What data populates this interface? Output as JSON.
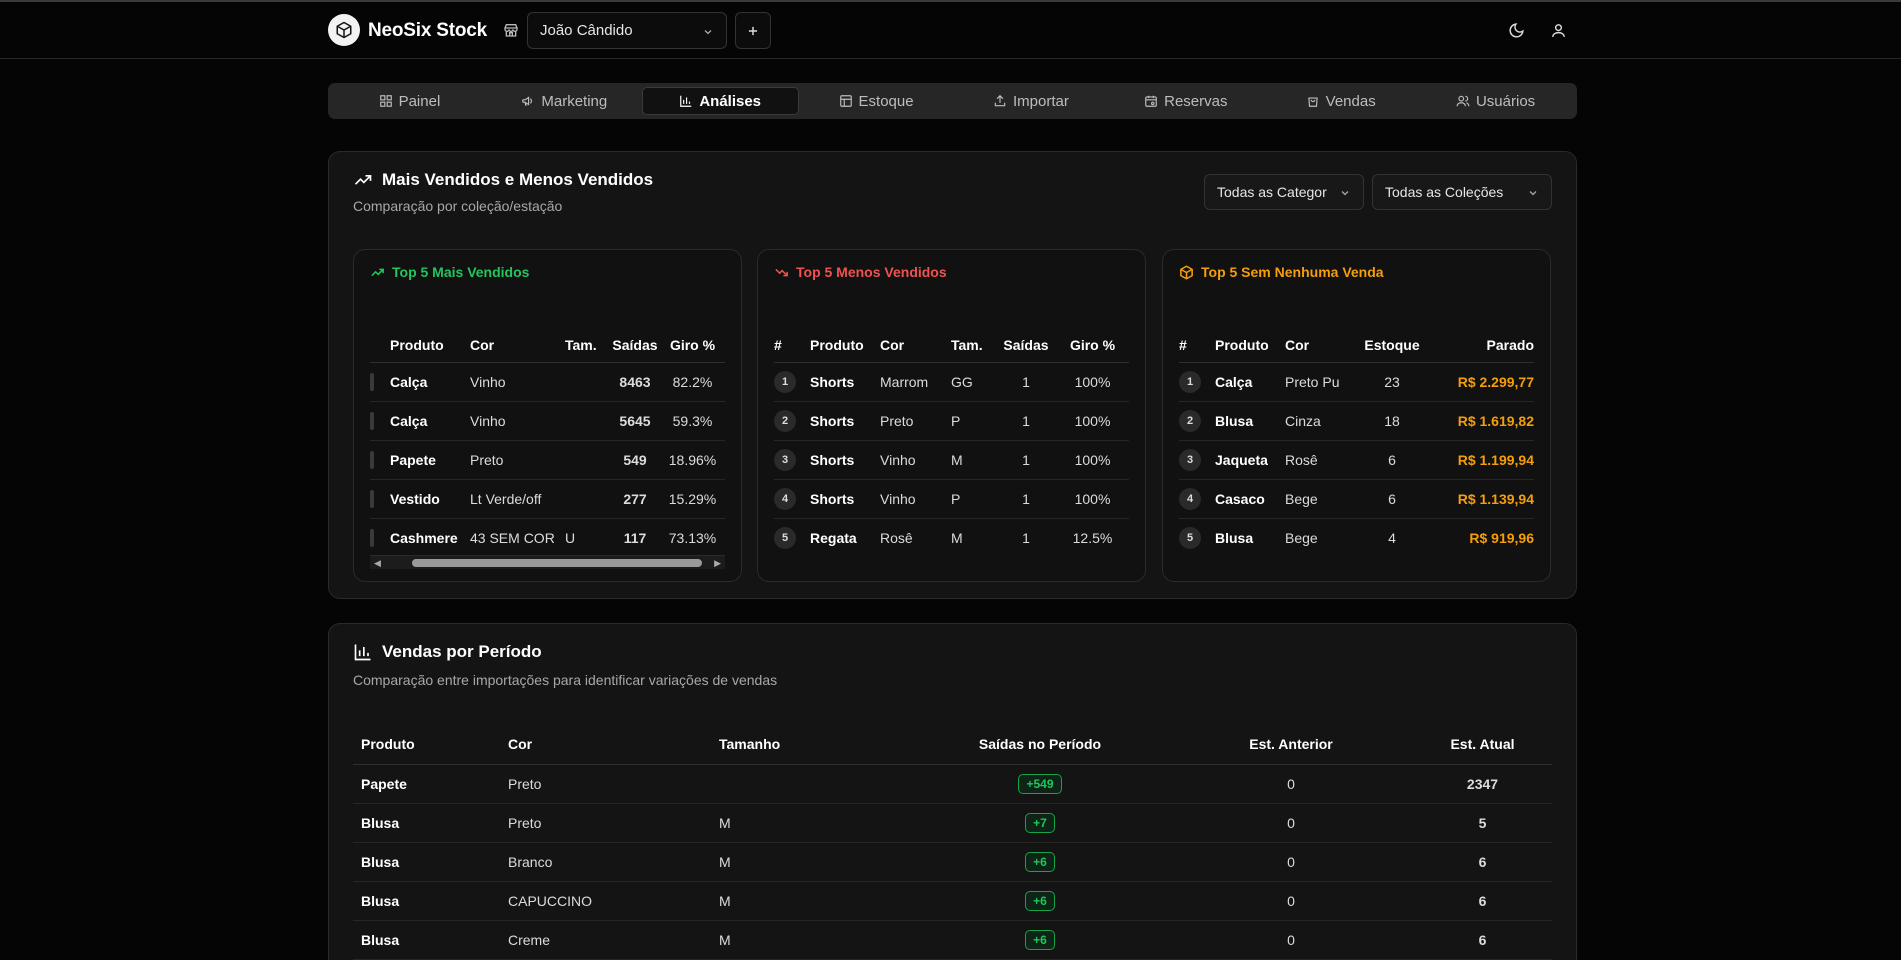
{
  "header": {
    "app_title": "NeoSix Stock",
    "store_selected": "João Cândido"
  },
  "nav": {
    "tabs": [
      {
        "label": "Painel",
        "icon": "dashboard-icon"
      },
      {
        "label": "Marketing",
        "icon": "megaphone-icon"
      },
      {
        "label": "Análises",
        "icon": "bar-chart-icon",
        "active": true
      },
      {
        "label": "Estoque",
        "icon": "table-icon"
      },
      {
        "label": "Importar",
        "icon": "upload-icon"
      },
      {
        "label": "Reservas",
        "icon": "calendar-icon"
      },
      {
        "label": "Vendas",
        "icon": "shopping-bag-icon"
      },
      {
        "label": "Usuários",
        "icon": "users-icon"
      }
    ]
  },
  "best_sellers": {
    "title": "Mais Vendidos e Menos Vendidos",
    "subtitle": "Comparação por coleção/estação",
    "filter_category": "Todas as Categor",
    "filter_collection": "Todas as Coleções",
    "top": {
      "title": "Top 5 Mais Vendidos",
      "headers": [
        "Produto",
        "Cor",
        "Tam.",
        "Saídas",
        "Giro %"
      ],
      "rows": [
        {
          "produto": "Calça",
          "cor": "Vinho",
          "tam": "",
          "saidas": "8463",
          "giro": "82.2%"
        },
        {
          "produto": "Calça",
          "cor": "Vinho",
          "tam": "",
          "saidas": "5645",
          "giro": "59.3%"
        },
        {
          "produto": "Papete",
          "cor": "Preto",
          "tam": "",
          "saidas": "549",
          "giro": "18.96%"
        },
        {
          "produto": "Vestido",
          "cor": "Lt Verde/off",
          "tam": "",
          "saidas": "277",
          "giro": "15.29%"
        },
        {
          "produto": "Cashmere",
          "cor": "43 SEM COR",
          "tam": "U",
          "saidas": "117",
          "giro": "73.13%"
        }
      ]
    },
    "bottom": {
      "title": "Top 5 Menos Vendidos",
      "headers": [
        "#",
        "Produto",
        "Cor",
        "Tam.",
        "Saídas",
        "Giro %"
      ],
      "rows": [
        {
          "rank": "1",
          "produto": "Shorts",
          "cor": "Marrom",
          "tam": "GG",
          "saidas": "1",
          "giro": "100%"
        },
        {
          "rank": "2",
          "produto": "Shorts",
          "cor": "Preto",
          "tam": "P",
          "saidas": "1",
          "giro": "100%"
        },
        {
          "rank": "3",
          "produto": "Shorts",
          "cor": "Vinho",
          "tam": "M",
          "saidas": "1",
          "giro": "100%"
        },
        {
          "rank": "4",
          "produto": "Shorts",
          "cor": "Vinho",
          "tam": "P",
          "saidas": "1",
          "giro": "100%"
        },
        {
          "rank": "5",
          "produto": "Regata",
          "cor": "Rosê",
          "tam": "M",
          "saidas": "1",
          "giro": "12.5%"
        }
      ]
    },
    "nosale": {
      "title": "Top 5 Sem Nenhuma Venda",
      "headers": [
        "#",
        "Produto",
        "Cor",
        "Estoque",
        "Parado"
      ],
      "rows": [
        {
          "rank": "1",
          "produto": "Calça",
          "cor": "Preto Pu",
          "estoque": "23",
          "parado": "R$ 2.299,77"
        },
        {
          "rank": "2",
          "produto": "Blusa",
          "cor": "Cinza",
          "estoque": "18",
          "parado": "R$ 1.619,82"
        },
        {
          "rank": "3",
          "produto": "Jaqueta",
          "cor": "Rosê",
          "estoque": "6",
          "parado": "R$ 1.199,94"
        },
        {
          "rank": "4",
          "produto": "Casaco",
          "cor": "Bege",
          "estoque": "6",
          "parado": "R$ 1.139,94"
        },
        {
          "rank": "5",
          "produto": "Blusa",
          "cor": "Bege",
          "estoque": "4",
          "parado": "R$ 919,96"
        }
      ]
    }
  },
  "period_sales": {
    "title": "Vendas por Período",
    "subtitle": "Comparação entre importações para identificar variações de vendas",
    "headers": [
      "Produto",
      "Cor",
      "Tamanho",
      "Saídas no Período",
      "Est. Anterior",
      "Est. Atual"
    ],
    "rows": [
      {
        "produto": "Papete",
        "cor": "Preto",
        "tamanho": "",
        "saidas": "+549",
        "anterior": "0",
        "atual": "2347"
      },
      {
        "produto": "Blusa",
        "cor": "Preto",
        "tamanho": "M",
        "saidas": "+7",
        "anterior": "0",
        "atual": "5"
      },
      {
        "produto": "Blusa",
        "cor": "Branco",
        "tamanho": "M",
        "saidas": "+6",
        "anterior": "0",
        "atual": "6"
      },
      {
        "produto": "Blusa",
        "cor": "CAPUCCINO",
        "tamanho": "M",
        "saidas": "+6",
        "anterior": "0",
        "atual": "6"
      },
      {
        "produto": "Blusa",
        "cor": "Creme",
        "tamanho": "M",
        "saidas": "+6",
        "anterior": "0",
        "atual": "6"
      }
    ]
  },
  "colors": {
    "green": "#22c55e",
    "red": "#f05252",
    "orange": "#f59e0b",
    "background": "#050505"
  }
}
